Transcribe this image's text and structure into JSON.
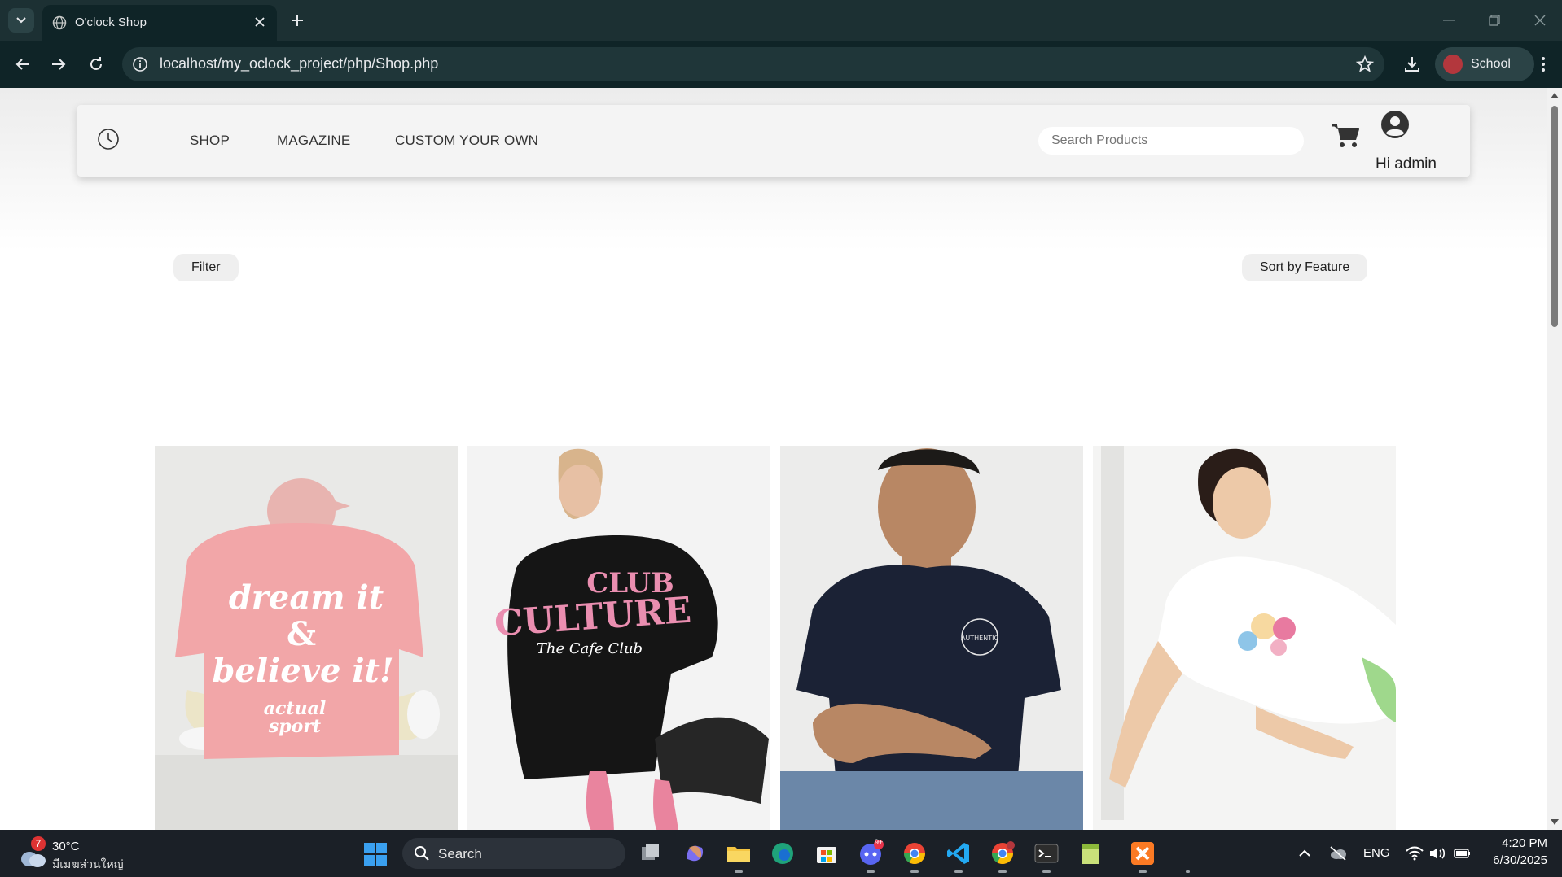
{
  "browser": {
    "tab_title": "O'clock Shop",
    "url": "localhost/my_oclock_project/php/Shop.php",
    "profile_label": "School"
  },
  "site": {
    "nav": [
      "SHOP",
      "MAGAZINE",
      "CUSTOM YOUR OWN"
    ],
    "search_placeholder": "Search Products",
    "greeting": "Hi admin",
    "filter_label": "Filter",
    "sort_label": "Sort by Feature"
  },
  "products": [
    {
      "image": "pink oversized t-shirt back print 'dream it & believe it'",
      "color": "#f2a6a8"
    },
    {
      "image": "black oversized t-shirt with pink 'CLUB' back print",
      "color": "#151515"
    },
    {
      "image": "navy t-shirt with small chest print",
      "color": "#1b2235"
    },
    {
      "image": "white t-shirt with cartoon print",
      "color": "#f4f4f2"
    }
  ],
  "taskbar": {
    "weather_temp": "30°C",
    "weather_cond": "มีเมฆส่วนใหญ่",
    "weather_badge": "7",
    "search_label": "Search",
    "lang": "ENG",
    "time": "4:20 PM",
    "date": "6/30/2025",
    "discord_badge": "9+"
  }
}
